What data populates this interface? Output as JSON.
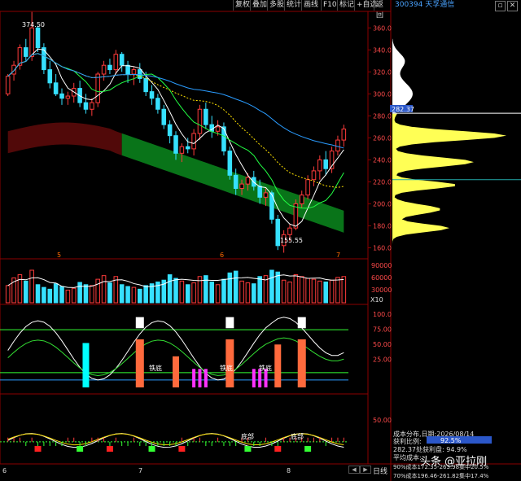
{
  "toolbar": {
    "buttons": [
      "复权",
      "叠加",
      "多股",
      "统计",
      "画线",
      "F10",
      "标记",
      "+自选",
      "返回"
    ],
    "stock_code": "300394",
    "stock_name": "天孚通信"
  },
  "colors": {
    "up": "#ff3b3b",
    "down": "#36e0ff",
    "ma5": "#ffffff",
    "ma10": "#ffe200",
    "ma20": "#ff33ff",
    "ma60": "#2a9cff",
    "gridline": "#3a0000",
    "bull": "#ff3333",
    "bear": "#00ffff"
  },
  "price_panel": {
    "high_label": "374.50",
    "low_label": "155.55",
    "current_price": "282.37",
    "period_markers": [
      "5",
      "6",
      "7"
    ],
    "axis_ticks": [
      "360.0",
      "340.0",
      "320.0",
      "300.0",
      "280.0",
      "260.0",
      "240.0",
      "220.0",
      "200.0",
      "180.0",
      "160.0"
    ]
  },
  "volume_panel": {
    "axis_ticks": [
      "90000",
      "60000",
      "30000"
    ],
    "unit": "X10"
  },
  "indicator_panel": {
    "axis_ticks": [
      "100.0",
      "75.00",
      "50.00",
      "25.00"
    ],
    "labels": [
      "铁底",
      "铁底",
      "铁底"
    ]
  },
  "bottom_panel": {
    "axis_ticks": [
      "50.00"
    ],
    "labels": [
      "底部",
      "底部"
    ]
  },
  "x_axis": {
    "labels": [
      "6",
      "7",
      "8"
    ]
  },
  "chips": {
    "title": "成本分布,日期:",
    "date": "2026/08/14",
    "profit_ratio_label": "获利比例:",
    "profit_ratio": "92.5%",
    "profit_line": "282.37处获利盘: 94.9%",
    "avg_cost_label": "平均成本:",
    "cost_90": "90%成本172.35-263.98集中20.5%",
    "cost_70": "70%成本196.46-261.82集中17.4%"
  },
  "side_labels": {
    "day_button": "日线",
    "watermark": "头条 @亚拉刚"
  },
  "chart_data": {
    "type": "candlestick",
    "title": "",
    "y_range": [
      150,
      375
    ],
    "candles": [
      [
        300,
        318,
        298,
        316
      ],
      [
        318,
        330,
        312,
        326
      ],
      [
        326,
        345,
        322,
        342
      ],
      [
        342,
        350,
        330,
        334
      ],
      [
        334,
        374.5,
        330,
        360
      ],
      [
        360,
        362,
        338,
        342
      ],
      [
        342,
        346,
        318,
        322
      ],
      [
        322,
        330,
        305,
        310
      ],
      [
        310,
        318,
        298,
        300
      ],
      [
        300,
        305,
        290,
        296
      ],
      [
        296,
        302,
        290,
        298
      ],
      [
        298,
        310,
        292,
        305
      ],
      [
        305,
        312,
        288,
        292
      ],
      [
        292,
        300,
        282,
        286
      ],
      [
        286,
        296,
        280,
        292
      ],
      [
        292,
        320,
        288,
        318
      ],
      [
        318,
        330,
        312,
        326
      ],
      [
        326,
        332,
        318,
        322
      ],
      [
        322,
        340,
        318,
        336
      ],
      [
        336,
        338,
        320,
        326
      ],
      [
        326,
        330,
        310,
        318
      ],
      [
        318,
        325,
        308,
        322
      ],
      [
        322,
        328,
        310,
        314
      ],
      [
        314,
        320,
        298,
        302
      ],
      [
        302,
        308,
        290,
        296
      ],
      [
        296,
        300,
        282,
        286
      ],
      [
        286,
        290,
        268,
        272
      ],
      [
        272,
        276,
        255,
        262
      ],
      [
        262,
        266,
        240,
        246
      ],
      [
        246,
        255,
        238,
        252
      ],
      [
        252,
        260,
        246,
        250
      ],
      [
        250,
        268,
        244,
        264
      ],
      [
        264,
        290,
        258,
        286
      ],
      [
        286,
        292,
        268,
        272
      ],
      [
        272,
        280,
        260,
        266
      ],
      [
        266,
        276,
        262,
        270
      ],
      [
        270,
        274,
        244,
        248
      ],
      [
        248,
        252,
        222,
        226
      ],
      [
        226,
        232,
        208,
        214
      ],
      [
        214,
        222,
        208,
        218
      ],
      [
        218,
        228,
        212,
        224
      ],
      [
        224,
        230,
        212,
        216
      ],
      [
        216,
        222,
        200,
        206
      ],
      [
        206,
        214,
        198,
        210
      ],
      [
        210,
        212,
        182,
        186
      ],
      [
        186,
        190,
        158,
        162
      ],
      [
        162,
        176,
        155.55,
        172
      ],
      [
        172,
        182,
        166,
        178
      ],
      [
        178,
        204,
        176,
        200
      ],
      [
        200,
        212,
        196,
        208
      ],
      [
        208,
        226,
        204,
        222
      ],
      [
        222,
        234,
        216,
        230
      ],
      [
        230,
        244,
        222,
        240
      ],
      [
        240,
        248,
        226,
        232
      ],
      [
        232,
        252,
        228,
        248
      ],
      [
        248,
        262,
        244,
        258
      ],
      [
        258,
        272,
        252,
        268
      ]
    ],
    "volume": [
      38,
      55,
      62,
      48,
      72,
      40,
      34,
      30,
      42,
      36,
      28,
      32,
      45,
      40,
      38,
      52,
      60,
      44,
      58,
      40,
      36,
      34,
      30,
      38,
      42,
      46,
      50,
      62,
      54,
      48,
      40,
      44,
      58,
      60,
      46,
      40,
      52,
      66,
      70,
      48,
      44,
      42,
      58,
      60,
      72,
      68,
      50,
      46,
      62,
      58,
      54,
      52,
      48,
      46,
      50,
      56,
      58
    ],
    "y_axis_ticks": [
      360,
      340,
      320,
      300,
      280,
      260,
      240,
      220,
      200,
      180,
      160
    ]
  }
}
